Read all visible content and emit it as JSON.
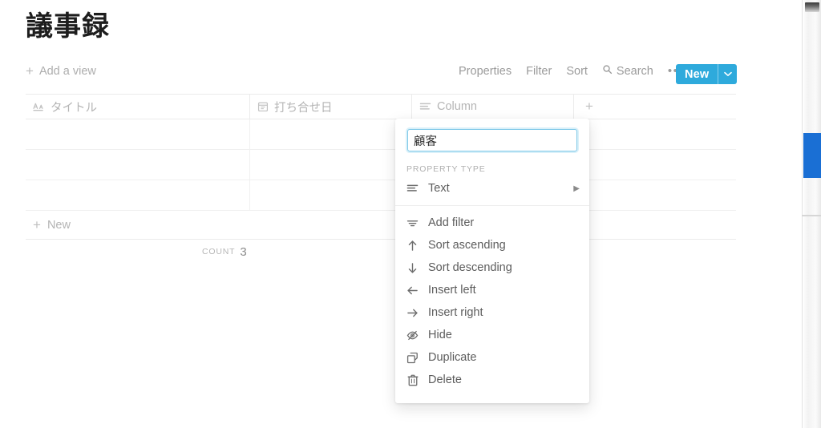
{
  "page": {
    "title": "議事録"
  },
  "viewbar": {
    "add_view_label": "Add a view",
    "plus_glyph": "+"
  },
  "toolbar": {
    "properties_label": "Properties",
    "filter_label": "Filter",
    "sort_label": "Sort",
    "search_label": "Search",
    "more_glyph": "•••",
    "new_label": "New",
    "new_caret_glyph": "⌄",
    "accent_color": "#2eaadc"
  },
  "table": {
    "columns": [
      {
        "label": "タイトル",
        "icon": "text-title-icon"
      },
      {
        "label": "打ち合せ日",
        "icon": "calendar-icon"
      },
      {
        "label": "Column",
        "icon": "text-lines-icon"
      }
    ],
    "add_column_glyph": "+",
    "rows": [
      {
        "cells": [
          "",
          "",
          ""
        ]
      },
      {
        "cells": [
          "",
          "",
          ""
        ]
      },
      {
        "cells": [
          "",
          "",
          ""
        ]
      }
    ],
    "new_row_label": "New",
    "new_row_plus": "+",
    "count_label": "COUNT",
    "count_value": "3"
  },
  "popup": {
    "name_value": "顧客",
    "name_placeholder": "",
    "property_type_label": "PROPERTY TYPE",
    "property_type": {
      "label": "Text",
      "icon": "text-lines-icon",
      "caret_glyph": "▶"
    },
    "menu_items": [
      {
        "label": "Add filter",
        "icon": "filter-icon"
      },
      {
        "label": "Sort ascending",
        "icon": "arrow-up-icon"
      },
      {
        "label": "Sort descending",
        "icon": "arrow-down-icon"
      },
      {
        "label": "Insert left",
        "icon": "arrow-left-icon"
      },
      {
        "label": "Insert right",
        "icon": "arrow-right-icon"
      },
      {
        "label": "Hide",
        "icon": "eye-off-icon"
      },
      {
        "label": "Duplicate",
        "icon": "duplicate-icon"
      },
      {
        "label": "Delete",
        "icon": "trash-icon"
      }
    ]
  },
  "edge": {
    "highlight_color": "#1a6fd4"
  }
}
